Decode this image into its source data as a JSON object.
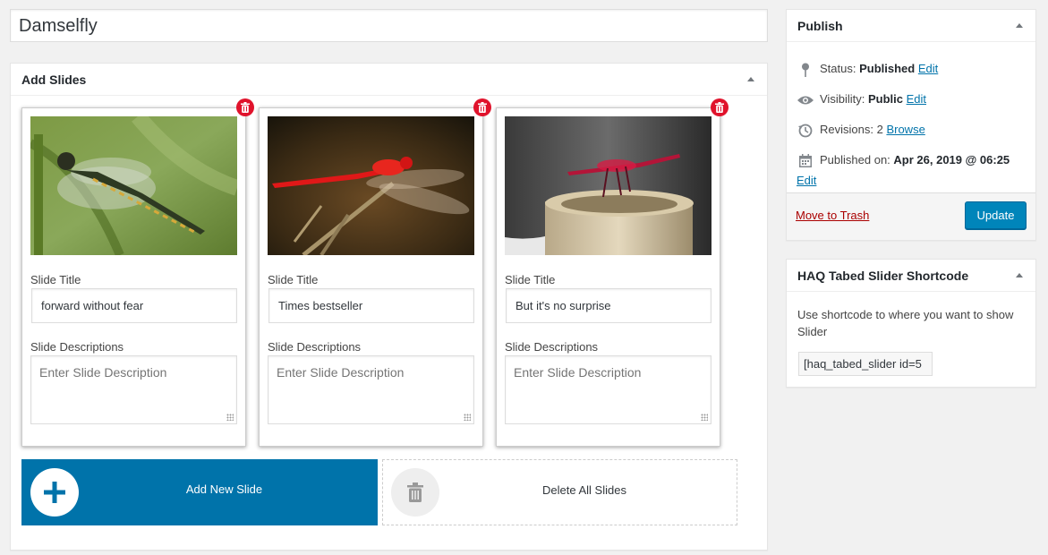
{
  "post_title": "Damselfly",
  "slides_box": {
    "title": "Add Slides"
  },
  "slides": [
    {
      "title_label": "Slide Title",
      "title_value": "forward without fear",
      "desc_label": "Slide Descriptions",
      "desc_placeholder": "Enter Slide Description"
    },
    {
      "title_label": "Slide Title",
      "title_value": "Times bestseller",
      "desc_label": "Slide Descriptions",
      "desc_placeholder": "Enter Slide Description"
    },
    {
      "title_label": "Slide Title",
      "title_value": "But it's no surprise",
      "desc_label": "Slide Descriptions",
      "desc_placeholder": "Enter Slide Description"
    }
  ],
  "actions": {
    "add_label": "Add New Slide",
    "delete_all_label": "Delete All Slides"
  },
  "publish": {
    "title": "Publish",
    "status_label": "Status:",
    "status_value": "Published",
    "status_edit": "Edit",
    "visibility_label": "Visibility:",
    "visibility_value": "Public",
    "visibility_edit": "Edit",
    "revisions_label": "Revisions:",
    "revisions_value": "2",
    "revisions_link": "Browse",
    "published_label": "Published on:",
    "published_value": "Apr 26, 2019 @ 06:25",
    "published_edit": "Edit",
    "trash_label": "Move to Trash",
    "update_label": "Update"
  },
  "shortcode": {
    "title": "HAQ Tabed Slider Shortcode",
    "description": "Use shortcode to where you want to show Slider",
    "value": "[haq_tabed_slider id=5"
  },
  "colors": {
    "accent": "#0073aa",
    "primary_button": "#0085ba",
    "delete_badge": "#e0132c",
    "trash_link": "#aa0000"
  }
}
